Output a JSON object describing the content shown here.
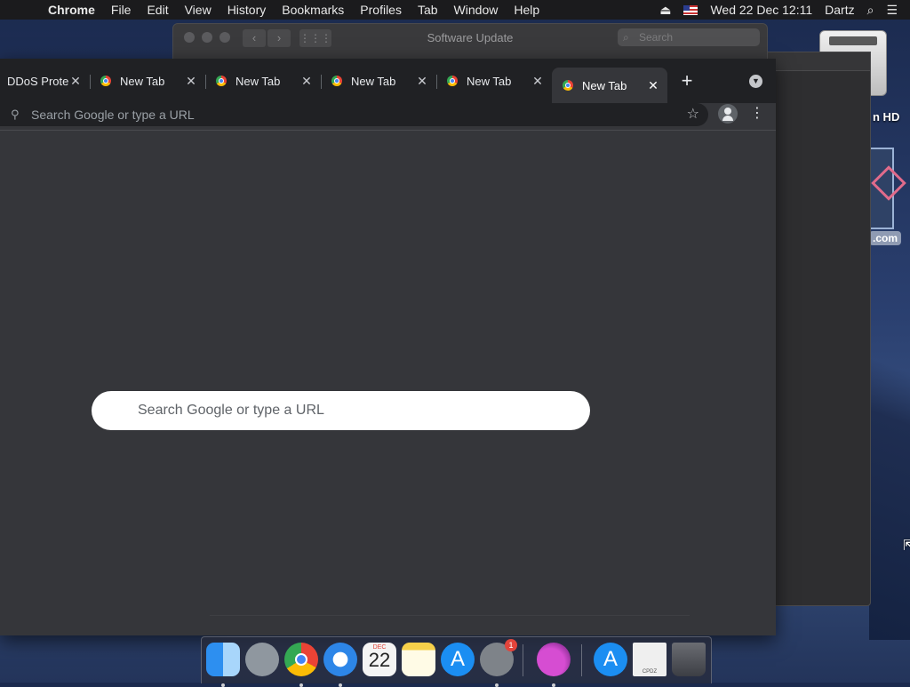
{
  "menubar": {
    "apple": "",
    "app_name": "Chrome",
    "items": [
      "File",
      "Edit",
      "View",
      "History",
      "Bookmarks",
      "Profiles",
      "Tab",
      "Window",
      "Help"
    ],
    "datetime": "Wed 22 Dec  12:11",
    "user": "Dartz"
  },
  "software_update": {
    "title": "Software Update",
    "search_placeholder": "Search"
  },
  "desktop": {
    "drive_label": "n HD",
    "dmg_label": ".com"
  },
  "chrome": {
    "tabs": [
      {
        "label": "DDoS Prote"
      },
      {
        "label": "New Tab"
      },
      {
        "label": "New Tab"
      },
      {
        "label": "New Tab"
      },
      {
        "label": "New Tab"
      },
      {
        "label": "New Tab"
      }
    ],
    "omnibox_placeholder": "Search Google or type a URL",
    "ntp_search_placeholder": "Search Google or type a URL"
  },
  "dock": {
    "calendar_month": "DEC",
    "calendar_day": "22",
    "sysprefs_badge": "1",
    "zip_label": "CPDZ"
  }
}
